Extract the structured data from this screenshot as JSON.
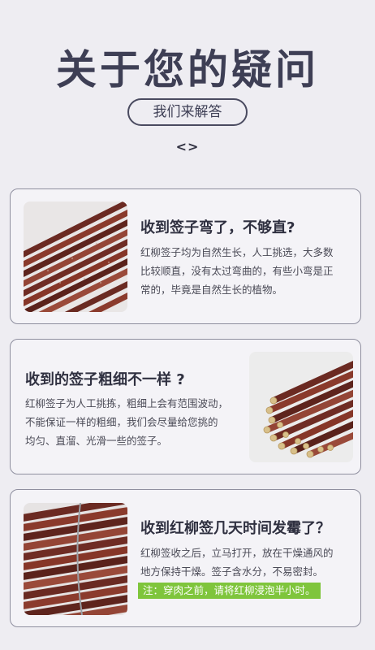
{
  "header": {
    "title": "关于您的疑问",
    "subtitle": "我们来解答",
    "chevrons": "<>"
  },
  "faq": [
    {
      "question": "收到签子弯了，不够直?",
      "answer_lines": [
        "红柳签子均为自然生长，人工挑选，大多数",
        "比较顺直，没有太过弯曲的，有些小弯是正",
        "常的，毕竟是自然生长的植物。"
      ],
      "image": "red-willow-sticks-bundle-photo"
    },
    {
      "question": "收到的签子粗细不一样 ?",
      "answer_lines": [
        "红柳签子为人工挑拣，粗细上会有范围波动，",
        "不能保证一样的粗细，我们会尽量给您挑的",
        "均匀、直溜、光滑一些的签子。"
      ],
      "image": "red-willow-sticks-ends-photo"
    },
    {
      "question": "收到红柳签几天时间发霉了？",
      "answer_lines": [
        "红柳签收之后，立马打开，放在干燥通风的",
        "地方保持干燥。签子含水分，不易密封。"
      ],
      "note": "注：穿肉之前，请将红柳浸泡半小时。",
      "note_color": "#7fc53c",
      "image": "tied-red-willow-bundle-photo"
    }
  ],
  "colors": {
    "background": "#eeedf2",
    "card_border": "#8f8f9f",
    "title": "#3e3f55",
    "note_bg": "#7fc53c"
  }
}
